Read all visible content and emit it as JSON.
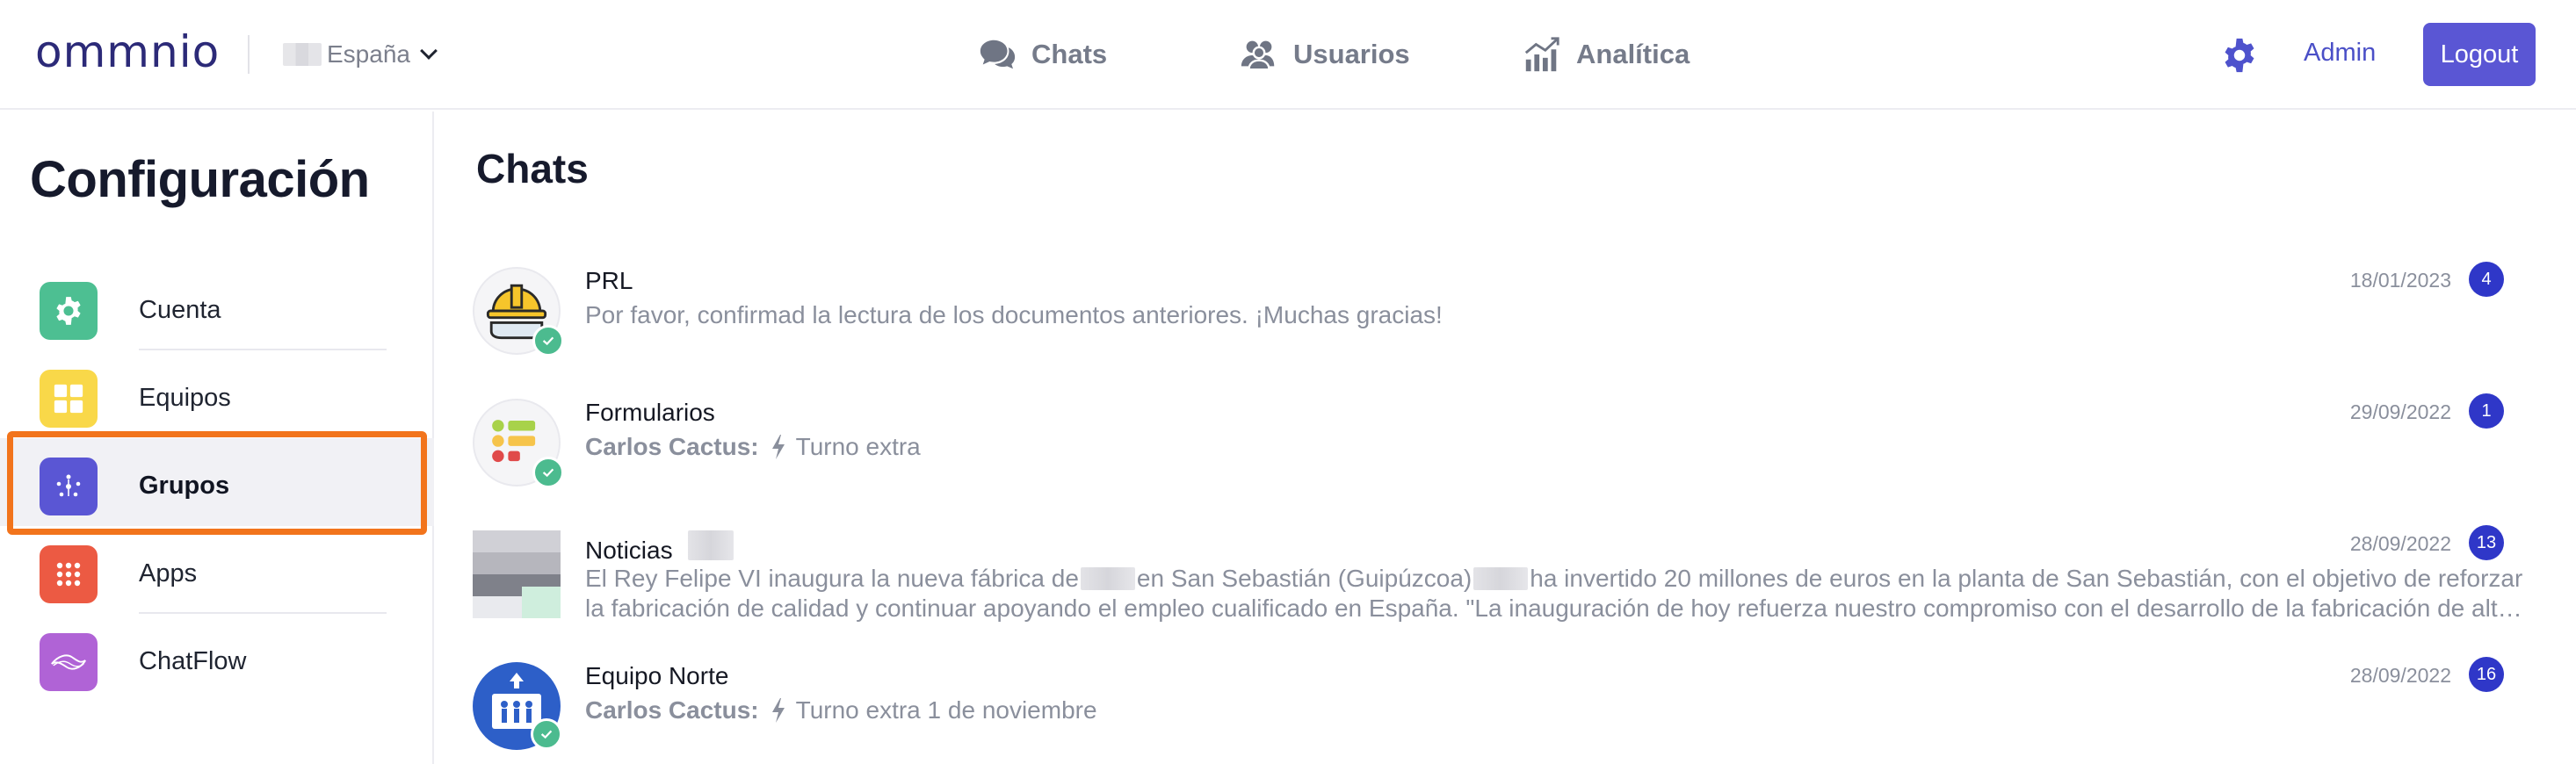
{
  "header": {
    "logo": "ommnio",
    "region": "España",
    "nav": [
      {
        "label": "Chats",
        "icon": "chat-bubbles-icon"
      },
      {
        "label": "Usuarios",
        "icon": "users-icon"
      },
      {
        "label": "Analítica",
        "icon": "analytics-icon"
      }
    ],
    "settings_icon": "gear-icon",
    "admin_label": "Admin",
    "logout_label": "Logout"
  },
  "sidebar": {
    "title": "Configuración",
    "items": [
      {
        "label": "Cuenta",
        "icon": "gear-icon",
        "color": "#4dbf92"
      },
      {
        "label": "Equipos",
        "icon": "grid-icon",
        "color": "#f9d849"
      },
      {
        "label": "Grupos",
        "icon": "group-icon",
        "color": "#5a56d4",
        "active": true
      },
      {
        "label": "Apps",
        "icon": "apps-dots-icon",
        "color": "#ec5a43"
      },
      {
        "label": "ChatFlow",
        "icon": "chatflow-icon",
        "color": "#b063d6"
      }
    ]
  },
  "main": {
    "title": "Chats",
    "chats": [
      {
        "name": "PRL",
        "date": "18/01/2023",
        "unread": "4",
        "sender": "",
        "message": "Por favor, confirmad la lectura de los documentos anteriores. ¡Muchas gracias!"
      },
      {
        "name": "Formularios",
        "date": "29/09/2022",
        "unread": "1",
        "sender": "Carlos Cactus:",
        "message": "Turno extra"
      },
      {
        "name": "Noticias",
        "date": "28/09/2022",
        "unread": "13",
        "sender": "",
        "message_parts": [
          "El Rey Felipe VI inaugura la nueva fábrica de",
          "en San Sebastián (Guipúzcoa)",
          "ha invertido 20 millones de euros en la planta de San Sebastián, con el objetivo de reforzar la fabricación de calidad y continuar apoyando el empleo cualificado en España. \"La inauguración de hoy refuerza nuestro compromiso con el desarrollo de la fabricación de alta calidad en España\""
        ]
      },
      {
        "name": "Equipo Norte",
        "date": "28/09/2022",
        "unread": "16",
        "sender": "Carlos Cactus:",
        "message": "Turno extra 1 de noviembre"
      }
    ]
  },
  "colors": {
    "accent": "#5a56d4",
    "badge": "#2f37c8",
    "check": "#4cbb8f",
    "highlight": "#f2741c"
  }
}
